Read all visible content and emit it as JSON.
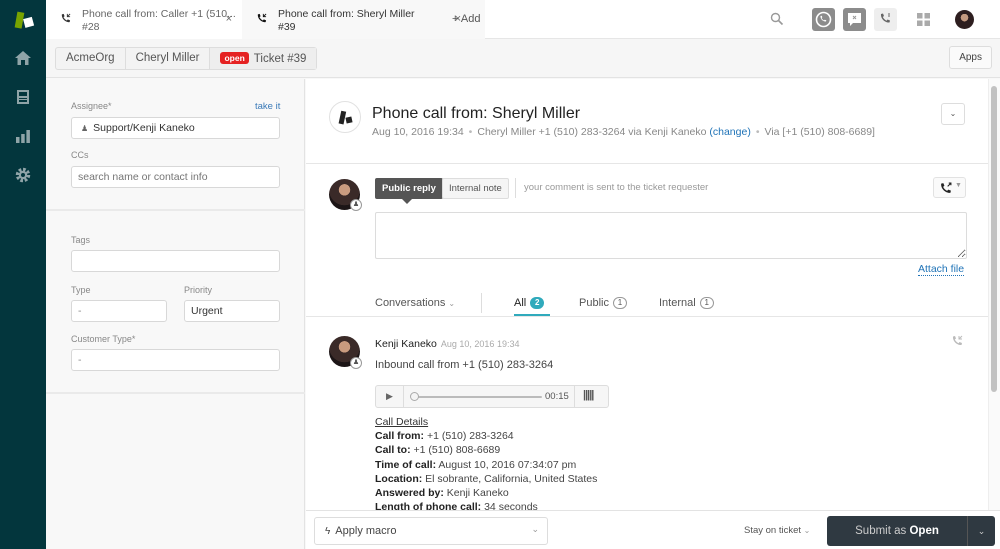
{
  "nav": {
    "items": [
      {
        "name": "home",
        "icon": "home-icon"
      },
      {
        "name": "views",
        "icon": "inbox-icon"
      },
      {
        "name": "reporting",
        "icon": "bar-chart-icon"
      },
      {
        "name": "admin",
        "icon": "gear-icon"
      }
    ]
  },
  "tabs": [
    {
      "title": "Phone call from: Caller +1 (510...",
      "sub": "#28",
      "close": "×"
    },
    {
      "title": "Phone call from: Sheryl Miller",
      "sub": "#39",
      "close": "×"
    }
  ],
  "add_tab": "+ Add",
  "breadcrumb": {
    "org": "AcmeOrg",
    "user": "Cheryl Miller",
    "status_badge": "open",
    "ticket": "Ticket #39"
  },
  "apps_button": "Apps",
  "properties": {
    "assignee_label": "Assignee*",
    "take_it": "take it",
    "assignee_value": "Support/Kenji Kaneko",
    "ccs_label": "CCs",
    "ccs_placeholder": "search name or contact info",
    "tags_label": "Tags",
    "tags_value": "",
    "type_label": "Type",
    "type_value": "-",
    "priority_label": "Priority",
    "priority_value": "Urgent",
    "customer_type_label": "Customer Type*",
    "customer_type_value": "-"
  },
  "ticket": {
    "title": "Phone call from: Sheryl Miller",
    "date": "Aug 10, 2016 19:34",
    "requester": "Cheryl Miller +1 (510) 283-3264 via Kenji Kaneko",
    "change_link": "(change)",
    "via": "Via [+1 (510) 808-6689]"
  },
  "composer": {
    "public_reply": "Public reply",
    "internal_note": "Internal note",
    "hint": "your comment is sent to the ticket requester",
    "attach_file": "Attach file"
  },
  "filters": {
    "conversations": "Conversations",
    "tabs": [
      {
        "label": "All",
        "count": "2",
        "active": true
      },
      {
        "label": "Public",
        "count": "1",
        "active": false
      },
      {
        "label": "Internal",
        "count": "1",
        "active": false
      }
    ]
  },
  "event": {
    "author": "Kenji Kaneko",
    "timestamp": "Aug 10, 2016 19:34",
    "summary": "Inbound call from +1 (510) 283-3264",
    "recording_duration": "00:15",
    "recording_progress": 0,
    "details_title": "Call Details",
    "details": [
      {
        "label": "Call from:",
        "value": "+1 (510) 283-3264"
      },
      {
        "label": "Call to:",
        "value": "+1 (510) 808-6689"
      },
      {
        "label": "Time of call:",
        "value": "August 10, 2016 07:34:07 pm"
      },
      {
        "label": "Location:",
        "value": "El sobrante, California, United States"
      },
      {
        "label": "Answered by:",
        "value": "Kenji Kaneko"
      },
      {
        "label": "Length of phone call:",
        "value": "34 seconds"
      }
    ]
  },
  "footer": {
    "apply_macro": "Apply macro",
    "stay_on_ticket": "Stay on ticket",
    "submit_prefix": "Submit as ",
    "submit_status": "Open"
  }
}
